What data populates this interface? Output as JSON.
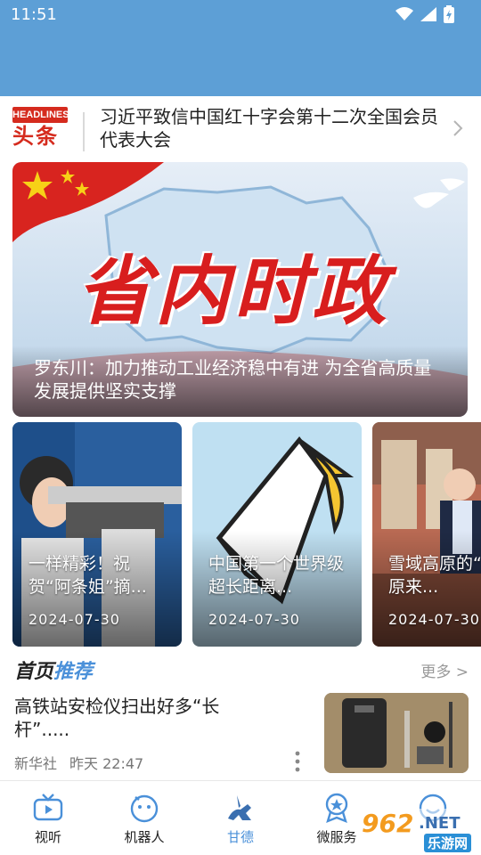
{
  "status_bar": {
    "time": "11:51"
  },
  "headline": {
    "logo_en": "HEADLINES",
    "logo_zh": "头条",
    "text": "习近平致信中国红十字会第十二次全国会员代表大会"
  },
  "hero": {
    "banner_text": "省内时政",
    "caption": "罗东川：加力推动工业经济稳中有进 为全省高质量发展提供坚实支撑"
  },
  "cards": [
    {
      "title": "一样精彩！祝贺“阿条姐”摘...",
      "date": "2024-07-30"
    },
    {
      "title": "中国第一个世界级超长距离...",
      "date": "2024-07-30"
    },
    {
      "title": "雪域高原的“藏”，原来...",
      "date": "2024-07-30"
    }
  ],
  "section": {
    "title_a": "首页",
    "title_b": "推荐",
    "more": "更多 >"
  },
  "news": {
    "title": "高铁站安检仪扫出好多“长杆”.....",
    "source": "新华社",
    "time": "昨天  22:47"
  },
  "bottom_nav": [
    {
      "label": "视听",
      "icon": "tv-icon"
    },
    {
      "label": "机器人",
      "icon": "robot-icon"
    },
    {
      "label": "甘德",
      "icon": "horse-rider-icon",
      "active": true
    },
    {
      "label": "微服务",
      "icon": "service-badge-icon"
    },
    {
      "label": "",
      "icon": "smile-icon"
    }
  ],
  "watermark": {
    "number": "962",
    "suffix": ".NET",
    "sub": "乐游网"
  },
  "colors": {
    "topbar": "#5d9fd6",
    "accent": "#4a90d9",
    "headline_red": "#d52b1e"
  }
}
